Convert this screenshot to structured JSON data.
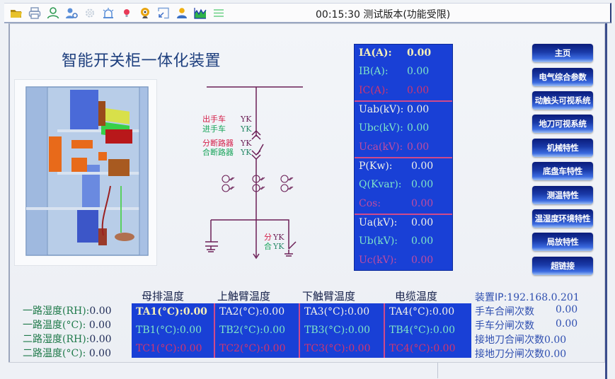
{
  "toolbar": {
    "icons": [
      "open-folder-icon",
      "print-icon",
      "user-icon",
      "user-settings-icon",
      "gear-icon",
      "alarm-icon",
      "bulb-icon",
      "webcam-icon",
      "minimize-window-icon",
      "person-icon",
      "chart-icon",
      "menu-icon"
    ],
    "clock": "00:15:30",
    "title": "测试版本(功能受限)"
  },
  "app_title": "智能开关柜一体化装置",
  "diagram": {
    "labels": {
      "out_cart": "出手车",
      "in_cart": "进手车",
      "open_breaker": "分断路器",
      "close_breaker": "合断路器",
      "open": "分",
      "close": "合",
      "yk": "YK"
    }
  },
  "measurements": {
    "group1": [
      {
        "label": "IA(A):",
        "value": "0.00"
      },
      {
        "label": "IB(A):",
        "value": "0.00"
      },
      {
        "label": "IC(A):",
        "value": "0.00"
      }
    ],
    "group2": [
      {
        "label": "Uab(kV):",
        "value": "0.00"
      },
      {
        "label": "Ubc(kV):",
        "value": "0.00"
      },
      {
        "label": "Uca(kV):",
        "value": "0.00"
      }
    ],
    "group3": [
      {
        "label": "P(Kw):",
        "value": "0.00"
      },
      {
        "label": "Q(Kvar):",
        "value": "0.00"
      },
      {
        "label": "Cos:",
        "value": "0.00"
      }
    ],
    "group4": [
      {
        "label": "Ua(kV):",
        "value": "0.00"
      },
      {
        "label": "Ub(kV):",
        "value": "0.00"
      },
      {
        "label": "Uc(kV):",
        "value": "0.00"
      }
    ]
  },
  "nav": [
    "主页",
    "电气综合参数",
    "动触头可视系统",
    "地刀可视系统",
    "机械特性",
    "底盘车特性",
    "测温特性",
    "温湿度环境特性",
    "局放特性",
    "超链接"
  ],
  "humidity": [
    {
      "label": "一路湿度",
      "unit": "(RH):",
      "value": "0.00"
    },
    {
      "label": "一路温度",
      "unit": "(°C): ",
      "value": "0.00"
    },
    {
      "label": "二路湿度",
      "unit": "(RH):",
      "value": "0.00"
    },
    {
      "label": "二路温度",
      "unit": "(°C): ",
      "value": "0.00"
    }
  ],
  "temperature": {
    "headers": [
      "母排温度",
      "上触臂温度",
      "下触臂温度",
      "电缆温度"
    ],
    "columns": [
      [
        {
          "label": "TA1(°C):",
          "value": "0.00"
        },
        {
          "label": "TB1(°C):",
          "value": "0.00"
        },
        {
          "label": "TC1(°C):",
          "value": "0.00"
        }
      ],
      [
        {
          "label": "TA2(°C):",
          "value": "0.00"
        },
        {
          "label": "TB2(°C):",
          "value": "0.00"
        },
        {
          "label": "TC2(°C):",
          "value": "0.00"
        }
      ],
      [
        {
          "label": "TA3(°C):",
          "value": "0.00"
        },
        {
          "label": "TB3(°C):",
          "value": "0.00"
        },
        {
          "label": "TC3(°C):",
          "value": "0.00"
        }
      ],
      [
        {
          "label": "TA4(°C):",
          "value": "0.00"
        },
        {
          "label": "TB4(°C):",
          "value": "0.00"
        },
        {
          "label": "TC4(°C):",
          "value": "0.00"
        }
      ]
    ]
  },
  "info": {
    "device_ip_label": "装置IP:",
    "device_ip": "192.168.0.201",
    "counters": [
      {
        "label": "手车合闸次数",
        "value": "0.00"
      },
      {
        "label": "手车分闸次数",
        "value": "0.00"
      },
      {
        "label": "接地刀合闸次数",
        "value": "0.00"
      },
      {
        "label": "接地刀分闸次数",
        "value": "0.00"
      }
    ]
  }
}
